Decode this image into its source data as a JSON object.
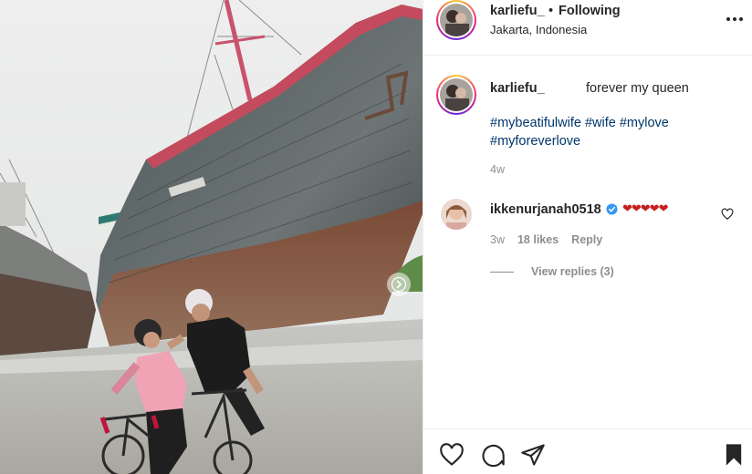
{
  "post": {
    "author": "karliefu_",
    "separator": "•",
    "follow_status": "Following",
    "location": "Jakarta, Indonesia"
  },
  "caption": {
    "author": "karliefu_",
    "text": "forever my queen",
    "hashtags": [
      "#mybeatifulwife",
      "#wife",
      "#mylove",
      "#myforeverlove"
    ],
    "time_ago": "4w"
  },
  "comment": {
    "author": "ikkenurjanah0518",
    "text": "❤❤❤❤❤",
    "time_ago": "3w",
    "likes": "18 likes",
    "reply_label": "Reply",
    "view_replies": "View replies (3)"
  },
  "icons": {
    "more": "more-options-icon",
    "carousel_next": "chevron-right-icon",
    "verified": "verified-badge-icon",
    "comment_like": "heart-outline-icon",
    "like": "heart-outline-icon",
    "comment": "comment-bubble-icon",
    "share": "paper-plane-icon",
    "save": "bookmark-filled-icon"
  },
  "colors": {
    "hashtag": "#00376b",
    "muted": "#8e8e8e",
    "text": "#262626",
    "hearts": "#c51f1f",
    "verified": "#3897f0"
  }
}
